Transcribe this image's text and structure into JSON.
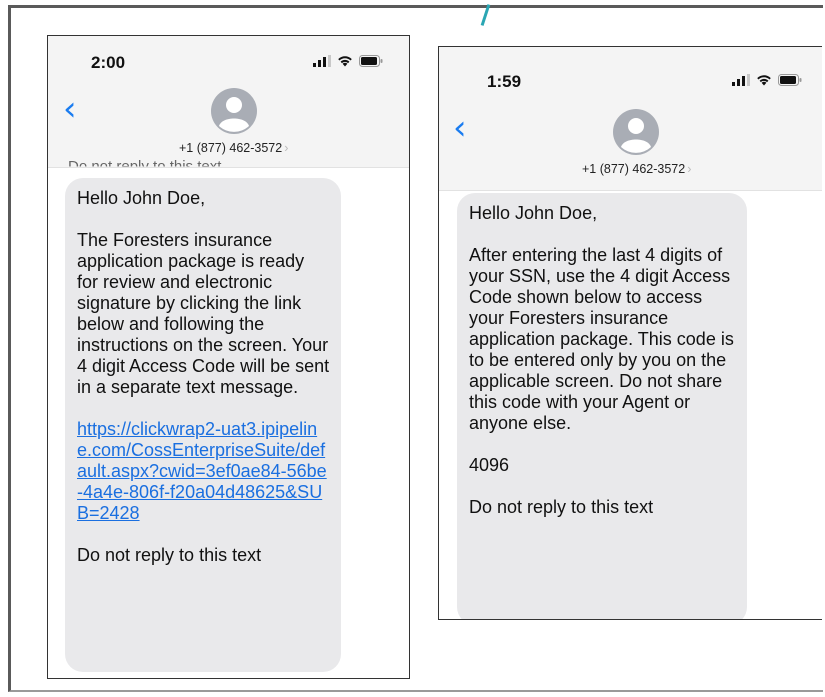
{
  "left_phone": {
    "time": "2:00",
    "contact": "+1 (877) 462-3572",
    "previous_message": "Do not reply to this text",
    "message": {
      "greeting": "Hello John Doe,",
      "body": "The Foresters insurance application package is ready for review and electronic signature by clicking the link below and following the instructions on the screen. Your 4 digit Access Code will be sent in a separate text message.",
      "link": "https://clickwrap2-uat3.ipipeline.com/CossEnterpriseSuite/default.aspx?cwid=3ef0ae84-56be-4a4e-806f-f20a04d48625&SUB=2428",
      "footer": "Do not reply to this text"
    }
  },
  "right_phone": {
    "time": "1:59",
    "contact": "+1 (877) 462-3572",
    "message": {
      "greeting": "Hello John Doe,",
      "body": "After entering the last 4 digits of your SSN, use the 4 digit Access Code shown below to access your Foresters insurance application package. This code is to be entered only by you on the applicable screen. Do not share this code with your Agent or anyone else.",
      "code": "4096",
      "footer": "Do not reply to this text"
    }
  },
  "icons": {
    "back": "chevron-left-icon",
    "avatar": "contact-avatar-icon",
    "signal": "cellular-signal-icon",
    "wifi": "wifi-icon",
    "battery": "battery-icon"
  },
  "colors": {
    "link": "#1a6fe0",
    "back_button": "#1a7cf0",
    "bubble": "#e9e9eb",
    "header": "#f4f4f4"
  }
}
